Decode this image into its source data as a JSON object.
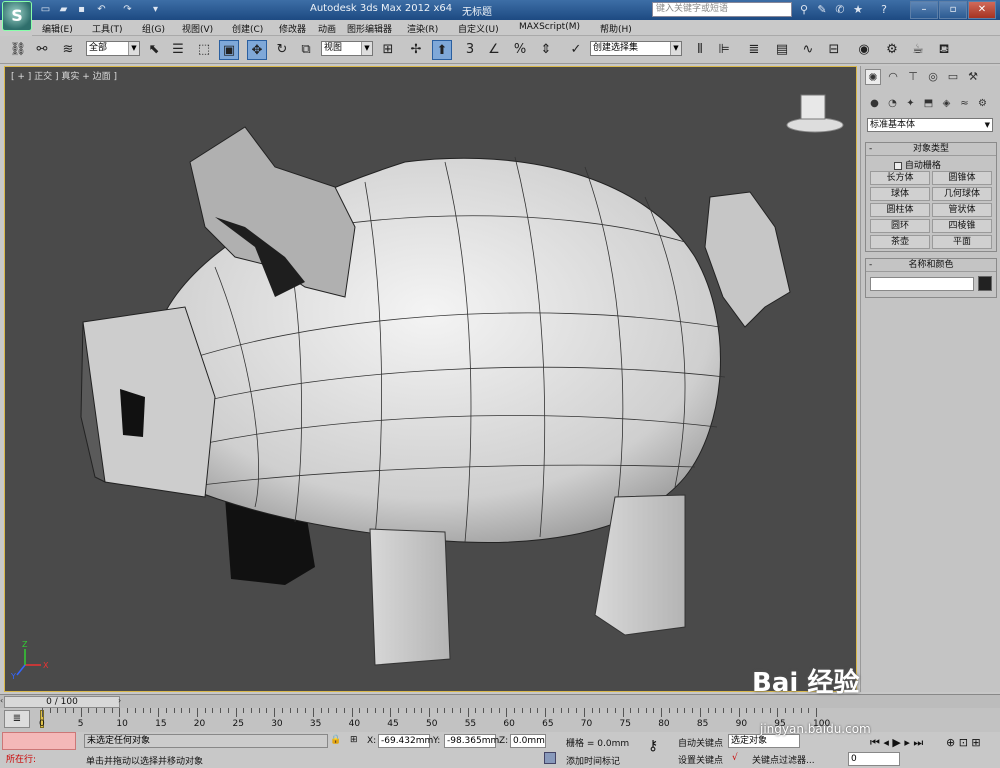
{
  "app": {
    "logo_letter": "S",
    "title": "Autodesk 3ds Max  2012 x64",
    "document": "无标题"
  },
  "search": {
    "placeholder": "键入关键字或短语"
  },
  "menu": [
    "编辑(E)",
    "工具(T)",
    "组(G)",
    "视图(V)",
    "创建(C)",
    "修改器",
    "动画",
    "图形编辑器",
    "渲染(R)",
    "自定义(U)",
    "MAXScript(M)",
    "帮助(H)"
  ],
  "toolbar": {
    "selection_filter": "全部",
    "ref_coord": "视图",
    "named_selection": "创建选择集",
    "snap_label": "3",
    "percent_label": "%"
  },
  "viewport": {
    "label": "[ + ] 正交 ] 真实 + 边面 ]",
    "axes": {
      "x": "X",
      "y": "Y",
      "z": "Z"
    }
  },
  "panel": {
    "category": "标准基本体",
    "rollout_object_type": "对象类型",
    "autogrid": "自动栅格",
    "buttons": [
      "长方体",
      "圆锥体",
      "球体",
      "几何球体",
      "圆柱体",
      "管状体",
      "圆环",
      "四棱锥",
      "茶壶",
      "平面"
    ],
    "rollout_name_color": "名称和颜色",
    "name_value": "",
    "swatch_color": "#222222"
  },
  "timeline": {
    "frame_display": "0 / 100",
    "ticks": [
      "0",
      "5",
      "10",
      "15",
      "20",
      "25",
      "30",
      "35",
      "40",
      "45",
      "50",
      "55",
      "60",
      "65",
      "70",
      "75",
      "80",
      "85",
      "90",
      "95",
      "100"
    ]
  },
  "status": {
    "script_label": "所在行:",
    "selection_info": "未选定任何对象",
    "prompt": "单击并拖动以选择并移动对象",
    "x_label": "X:",
    "x_value": "-69.432mm",
    "y_label": "Y:",
    "y_value": "-98.365mm",
    "z_label": "Z:",
    "z_value": "0.0mm",
    "grid": "栅格 = 0.0mm",
    "add_time_tag": "添加时间标记",
    "auto_key": "自动关键点",
    "selected_dropdown": "选定对象",
    "set_key": "设置关键点",
    "key_filters": "关键点过滤器...",
    "frame_value": "0"
  },
  "watermark": {
    "text": "Bai 经验",
    "url": "jingyan.baidu.com"
  },
  "colors": {
    "title_bar": "#1d4a82",
    "viewport_bg": "#4a4a4a",
    "active_border": "#d9b84a",
    "accent": "#7fa8d8"
  }
}
